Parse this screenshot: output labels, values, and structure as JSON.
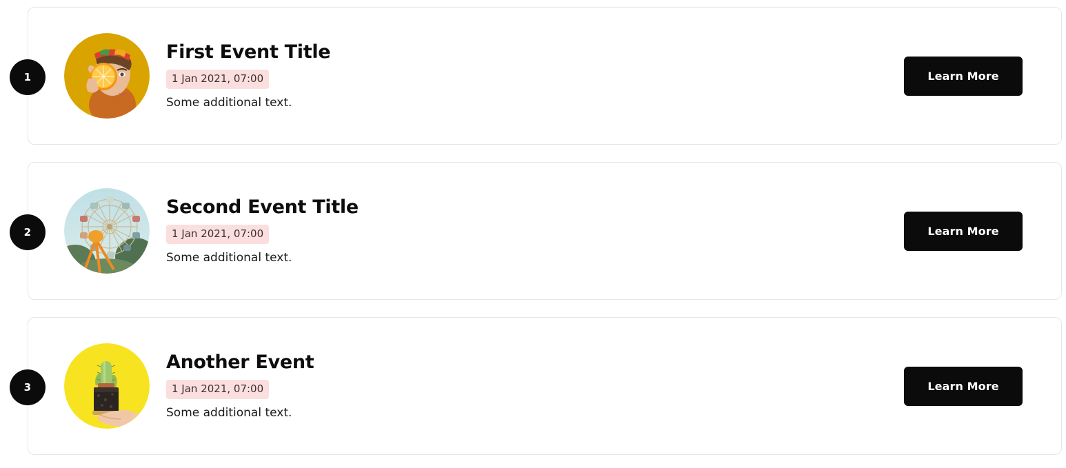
{
  "timeline": {
    "events": [
      {
        "number": "1",
        "title": "First Event Title",
        "date": "1 Jan 2021, 07:00",
        "description": "Some additional text.",
        "button_label": "Learn More",
        "image_name": "woman-with-orange-slice-photo",
        "image_alt": "Woman holding an orange slice over her eye on a mustard yellow background"
      },
      {
        "number": "2",
        "title": "Second Event Title",
        "date": "1 Jan 2021, 07:00",
        "description": "Some additional text.",
        "button_label": "Learn More",
        "image_name": "ferris-wheel-photo",
        "image_alt": "Ferris wheel against a pale blue sky with trees"
      },
      {
        "number": "3",
        "title": "Another Event",
        "date": "1 Jan 2021, 07:00",
        "description": "Some additional text.",
        "button_label": "Learn More",
        "image_name": "hand-holding-cactus-photo",
        "image_alt": "Hand holding a potted cactus on a bright yellow background"
      }
    ]
  },
  "colors": {
    "page_background": "#ffffff",
    "card_border": "#e6e6e6",
    "badge_background": "#0b0b0b",
    "badge_text": "#ffffff",
    "date_badge_background": "#fbdede",
    "date_badge_text": "#3c3030",
    "title_text": "#0d0d0d",
    "description_text": "#1b1b1b",
    "button_background": "#0b0b0b",
    "button_text": "#ffffff"
  }
}
